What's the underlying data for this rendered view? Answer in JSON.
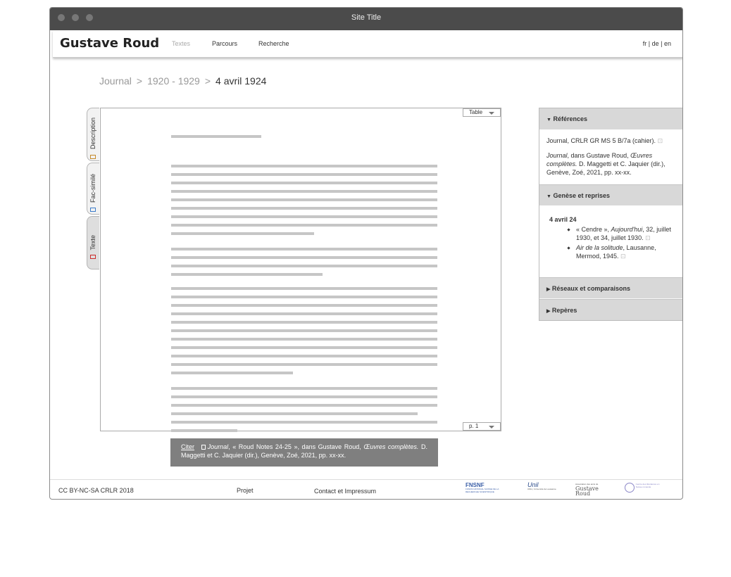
{
  "window": {
    "title": "Site Title"
  },
  "nav": {
    "brand": "Gustave Roud",
    "links": [
      "Textes",
      "Parcours",
      "Recherche"
    ],
    "lang": "fr | de | en"
  },
  "breadcrumb": {
    "items": [
      "Journal",
      "1920 - 1929"
    ],
    "current": "4 avril 1924",
    "separator": ">"
  },
  "side_tabs": [
    "Description",
    "Fac-similé",
    "Texte"
  ],
  "viewer": {
    "view_select": "Table",
    "page_select": "p. 1"
  },
  "citation": {
    "link": "Citer",
    "text_italic_1": "Journal",
    "text_1": ", « Roud Notes 24-25 », dans Gustave Roud,",
    "text_italic_2": "Œuvres complètes.",
    "text_2": "D. Maggetti et C. Jaquier (dir.), Genève, Zoé, 2021, pp. xx-xx."
  },
  "panel": {
    "references": {
      "title": "Références",
      "line1": "Journal, CRLR GR MS 5 B/7a (cahier).",
      "line2_italic": "Journal",
      "line2": ", dans Gustave Roud,",
      "line2_italic_b": "Œuvres complètes.",
      "line2_b": "D. Maggetti et C. Jaquier (dir.), Genève, Zoé, 2021, pp. xx-xx."
    },
    "genese": {
      "title": "Genèse et reprises",
      "date": "4 avril 24",
      "item1_a": "« Cendre »,",
      "item1_italic": "Aujourd'hui",
      "item1_b": ", 32, juillet 1930, et 34, juillet 1930.",
      "item2_italic": "Air de la solitude",
      "item2_b": ", Lausanne, Mermod, 1945."
    },
    "reseaux": {
      "title": "Réseaux et comparaisons"
    },
    "reperes": {
      "title": "Repères"
    }
  },
  "footer": {
    "license": "CC BY-NC-SA CRLR 2018",
    "projet": "Projet",
    "contact": "Contact et Impressum",
    "logo1": "FNSNF",
    "logo1_sub": "FONDS NATIONAL SUISSE DE LA RECHERCHE SCIENTIFIQUE",
    "logo2": "Unil",
    "logo2_sub": "UNIL | Université de Lausanne",
    "logo3": "Association des amis de",
    "logo3_b": "Gustave Roud",
    "logo4": "Centre des littératures en Suisse romande"
  }
}
